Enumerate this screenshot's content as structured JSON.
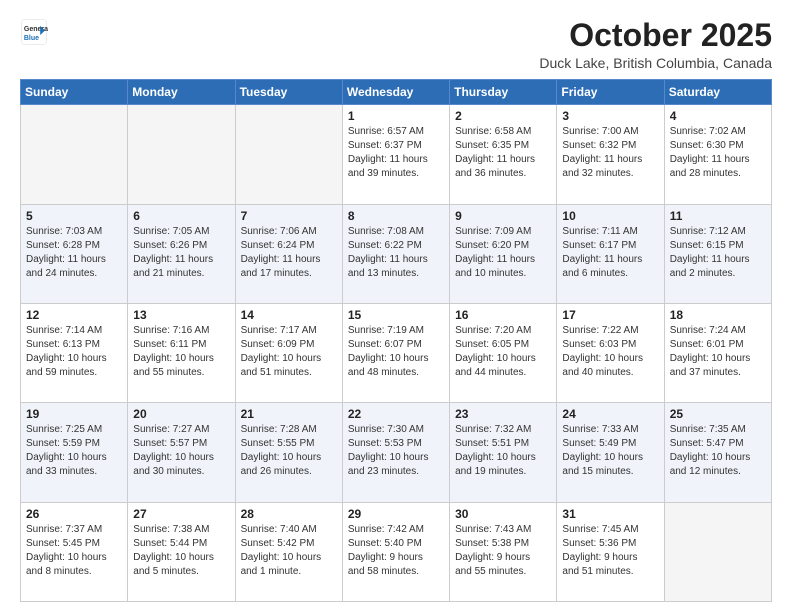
{
  "header": {
    "logo": {
      "line1": "General",
      "line2": "Blue"
    },
    "title": "October 2025",
    "location": "Duck Lake, British Columbia, Canada"
  },
  "weekdays": [
    "Sunday",
    "Monday",
    "Tuesday",
    "Wednesday",
    "Thursday",
    "Friday",
    "Saturday"
  ],
  "weeks": [
    [
      {
        "day": "",
        "info": ""
      },
      {
        "day": "",
        "info": ""
      },
      {
        "day": "",
        "info": ""
      },
      {
        "day": "1",
        "info": "Sunrise: 6:57 AM\nSunset: 6:37 PM\nDaylight: 11 hours\nand 39 minutes."
      },
      {
        "day": "2",
        "info": "Sunrise: 6:58 AM\nSunset: 6:35 PM\nDaylight: 11 hours\nand 36 minutes."
      },
      {
        "day": "3",
        "info": "Sunrise: 7:00 AM\nSunset: 6:32 PM\nDaylight: 11 hours\nand 32 minutes."
      },
      {
        "day": "4",
        "info": "Sunrise: 7:02 AM\nSunset: 6:30 PM\nDaylight: 11 hours\nand 28 minutes."
      }
    ],
    [
      {
        "day": "5",
        "info": "Sunrise: 7:03 AM\nSunset: 6:28 PM\nDaylight: 11 hours\nand 24 minutes."
      },
      {
        "day": "6",
        "info": "Sunrise: 7:05 AM\nSunset: 6:26 PM\nDaylight: 11 hours\nand 21 minutes."
      },
      {
        "day": "7",
        "info": "Sunrise: 7:06 AM\nSunset: 6:24 PM\nDaylight: 11 hours\nand 17 minutes."
      },
      {
        "day": "8",
        "info": "Sunrise: 7:08 AM\nSunset: 6:22 PM\nDaylight: 11 hours\nand 13 minutes."
      },
      {
        "day": "9",
        "info": "Sunrise: 7:09 AM\nSunset: 6:20 PM\nDaylight: 11 hours\nand 10 minutes."
      },
      {
        "day": "10",
        "info": "Sunrise: 7:11 AM\nSunset: 6:17 PM\nDaylight: 11 hours\nand 6 minutes."
      },
      {
        "day": "11",
        "info": "Sunrise: 7:12 AM\nSunset: 6:15 PM\nDaylight: 11 hours\nand 2 minutes."
      }
    ],
    [
      {
        "day": "12",
        "info": "Sunrise: 7:14 AM\nSunset: 6:13 PM\nDaylight: 10 hours\nand 59 minutes."
      },
      {
        "day": "13",
        "info": "Sunrise: 7:16 AM\nSunset: 6:11 PM\nDaylight: 10 hours\nand 55 minutes."
      },
      {
        "day": "14",
        "info": "Sunrise: 7:17 AM\nSunset: 6:09 PM\nDaylight: 10 hours\nand 51 minutes."
      },
      {
        "day": "15",
        "info": "Sunrise: 7:19 AM\nSunset: 6:07 PM\nDaylight: 10 hours\nand 48 minutes."
      },
      {
        "day": "16",
        "info": "Sunrise: 7:20 AM\nSunset: 6:05 PM\nDaylight: 10 hours\nand 44 minutes."
      },
      {
        "day": "17",
        "info": "Sunrise: 7:22 AM\nSunset: 6:03 PM\nDaylight: 10 hours\nand 40 minutes."
      },
      {
        "day": "18",
        "info": "Sunrise: 7:24 AM\nSunset: 6:01 PM\nDaylight: 10 hours\nand 37 minutes."
      }
    ],
    [
      {
        "day": "19",
        "info": "Sunrise: 7:25 AM\nSunset: 5:59 PM\nDaylight: 10 hours\nand 33 minutes."
      },
      {
        "day": "20",
        "info": "Sunrise: 7:27 AM\nSunset: 5:57 PM\nDaylight: 10 hours\nand 30 minutes."
      },
      {
        "day": "21",
        "info": "Sunrise: 7:28 AM\nSunset: 5:55 PM\nDaylight: 10 hours\nand 26 minutes."
      },
      {
        "day": "22",
        "info": "Sunrise: 7:30 AM\nSunset: 5:53 PM\nDaylight: 10 hours\nand 23 minutes."
      },
      {
        "day": "23",
        "info": "Sunrise: 7:32 AM\nSunset: 5:51 PM\nDaylight: 10 hours\nand 19 minutes."
      },
      {
        "day": "24",
        "info": "Sunrise: 7:33 AM\nSunset: 5:49 PM\nDaylight: 10 hours\nand 15 minutes."
      },
      {
        "day": "25",
        "info": "Sunrise: 7:35 AM\nSunset: 5:47 PM\nDaylight: 10 hours\nand 12 minutes."
      }
    ],
    [
      {
        "day": "26",
        "info": "Sunrise: 7:37 AM\nSunset: 5:45 PM\nDaylight: 10 hours\nand 8 minutes."
      },
      {
        "day": "27",
        "info": "Sunrise: 7:38 AM\nSunset: 5:44 PM\nDaylight: 10 hours\nand 5 minutes."
      },
      {
        "day": "28",
        "info": "Sunrise: 7:40 AM\nSunset: 5:42 PM\nDaylight: 10 hours\nand 1 minute."
      },
      {
        "day": "29",
        "info": "Sunrise: 7:42 AM\nSunset: 5:40 PM\nDaylight: 9 hours\nand 58 minutes."
      },
      {
        "day": "30",
        "info": "Sunrise: 7:43 AM\nSunset: 5:38 PM\nDaylight: 9 hours\nand 55 minutes."
      },
      {
        "day": "31",
        "info": "Sunrise: 7:45 AM\nSunset: 5:36 PM\nDaylight: 9 hours\nand 51 minutes."
      },
      {
        "day": "",
        "info": ""
      }
    ]
  ]
}
